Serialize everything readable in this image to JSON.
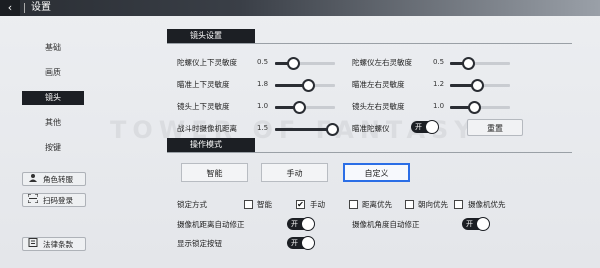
{
  "header": {
    "back_icon": "‹",
    "title": "设置"
  },
  "sidebar": {
    "items": [
      {
        "label": "基础",
        "active": false
      },
      {
        "label": "画质",
        "active": false
      },
      {
        "label": "镜头",
        "active": true
      },
      {
        "label": "其他",
        "active": false
      },
      {
        "label": "按键",
        "active": false
      }
    ],
    "buttons": [
      {
        "label": "角色转服",
        "icon": "user-transfer-icon"
      },
      {
        "label": "扫码登录",
        "icon": "qr-scan-icon"
      },
      {
        "label": "法律条款",
        "icon": "document-icon"
      }
    ]
  },
  "watermark": "TOWER OF FANTASY",
  "camera": {
    "title": "镜头设置",
    "sliders": [
      {
        "label": "陀螺仪上下灵敏度",
        "value": "0.5",
        "fraction": 0.3
      },
      {
        "label": "陀螺仪左右灵敏度",
        "value": "0.5",
        "fraction": 0.3
      },
      {
        "label": "瞄准上下灵敏度",
        "value": "1.8",
        "fraction": 0.55
      },
      {
        "label": "瞄准左右灵敏度",
        "value": "1.2",
        "fraction": 0.45
      },
      {
        "label": "镜头上下灵敏度",
        "value": "1.0",
        "fraction": 0.4
      },
      {
        "label": "镜头左右灵敏度",
        "value": "1.0",
        "fraction": 0.4
      },
      {
        "label": "战斗时摄像机距离",
        "value": "1.5",
        "fraction": 0.95
      }
    ],
    "gyro_toggle": {
      "label": "瞄准陀螺仪",
      "state": "开",
      "on": true
    },
    "reset_label": "重置"
  },
  "operation": {
    "title": "操作模式",
    "modes": [
      {
        "label": "智能",
        "active": false
      },
      {
        "label": "手动",
        "active": false
      },
      {
        "label": "自定义",
        "active": true
      }
    ],
    "lock_label": "锁定方式",
    "lock_options": [
      {
        "label": "智能",
        "checked": false
      },
      {
        "label": "手动",
        "checked": true
      },
      {
        "label": "距离优先",
        "checked": false
      },
      {
        "label": "朝向优先",
        "checked": false
      },
      {
        "label": "摄像机优先",
        "checked": false
      }
    ],
    "check_mark": "✔",
    "toggles": [
      {
        "label": "摄像机距离自动修正",
        "state": "开",
        "on": true
      },
      {
        "label": "摄像机角度自动修正",
        "state": "开",
        "on": true
      },
      {
        "label": "显示锁定按钮",
        "state": "开",
        "on": true
      }
    ]
  }
}
